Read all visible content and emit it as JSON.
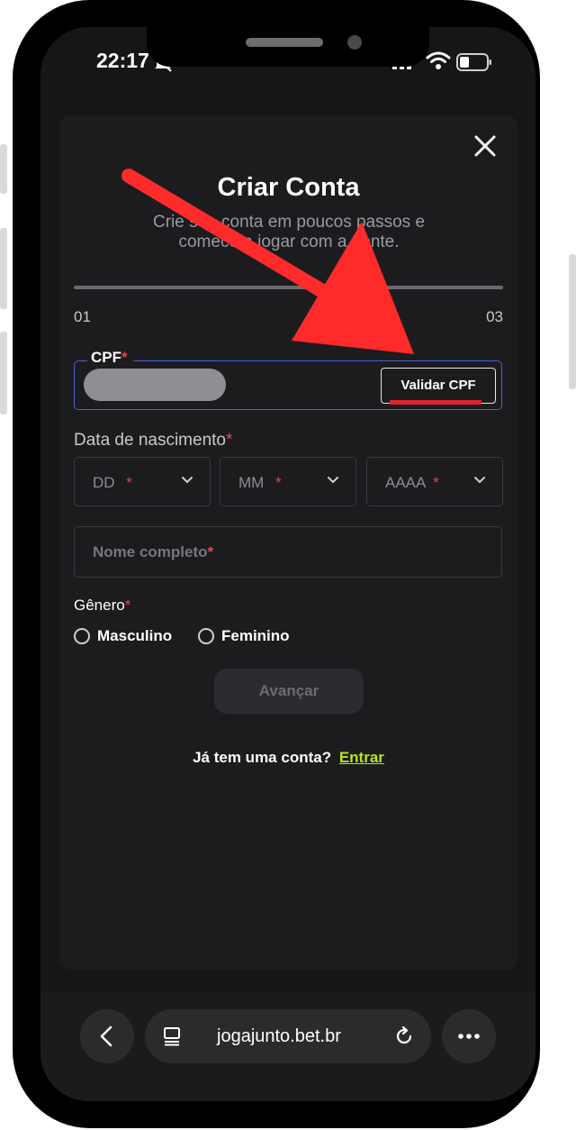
{
  "status_bar": {
    "time": "22:17"
  },
  "form": {
    "title": "Criar Conta",
    "subtitle": "Crie sua conta em poucos passos e comece a jogar com a gente.",
    "step_start": "01",
    "step_end": "03",
    "cpf_label": "CPF",
    "required_mark": "*",
    "validate_button": "Validar CPF",
    "birth_label": "Data de nascimento",
    "day_placeholder": "DD",
    "month_placeholder": "MM",
    "year_placeholder": "AAAA",
    "name_placeholder": "Nome completo",
    "gender_label": "Gênero",
    "gender_options": [
      "Masculino",
      "Feminino"
    ],
    "advance_button": "Avançar",
    "login_prompt": "Já tem uma conta?",
    "login_link": "Entrar"
  },
  "browser": {
    "url": "jogajunto.bet.br"
  },
  "colors": {
    "accent_link": "#b5e61d",
    "required": "#e04848",
    "focus_border": "#4a5fd8",
    "annotation_arrow": "#ff2a2a"
  },
  "icons": [
    "close-icon",
    "chevron-down-icon",
    "back-icon",
    "tab-icon",
    "reload-icon",
    "more-icon",
    "wifi-icon",
    "battery-icon",
    "mute-icon"
  ]
}
